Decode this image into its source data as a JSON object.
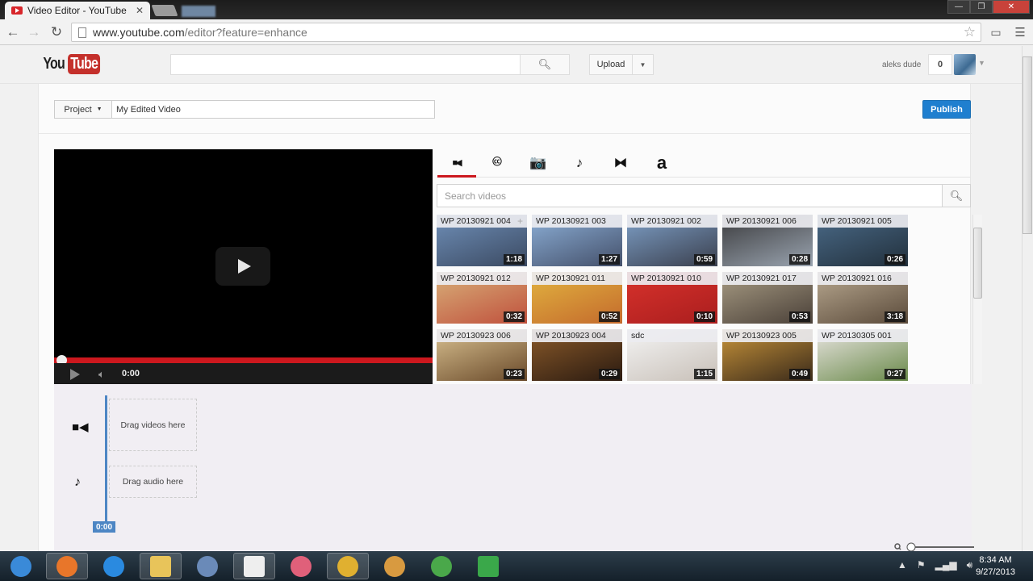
{
  "browser": {
    "tab_title": "Video Editor - YouTube",
    "tab_close": "✕",
    "url_host": "www.youtube.com",
    "url_path": "/editor?feature=enhance",
    "window_controls": [
      "—",
      "❐",
      "✕"
    ]
  },
  "header": {
    "logo_you": "You",
    "logo_tube": "Tube",
    "search_placeholder": "",
    "upload_label": "Upload",
    "username": "aleks dude",
    "notification_count": "0"
  },
  "project": {
    "menu_label": "Project",
    "name": "My Edited Video",
    "publish_label": "Publish"
  },
  "player": {
    "time": "0:00",
    "progress": 0
  },
  "tabs": [
    {
      "name": "tab-videos",
      "icon": "video-camera-icon",
      "glyph": "■◀",
      "active": true
    },
    {
      "name": "tab-creative-commons",
      "icon": "creative-commons-icon",
      "glyph": "🅭",
      "active": false
    },
    {
      "name": "tab-photos",
      "icon": "camera-icon",
      "glyph": "📷",
      "active": false
    },
    {
      "name": "tab-audio",
      "icon": "music-note-icon",
      "glyph": "♪",
      "active": false
    },
    {
      "name": "tab-transitions",
      "icon": "transition-icon",
      "glyph": "⧓",
      "active": false
    },
    {
      "name": "tab-text",
      "icon": "text-icon",
      "glyph": "a",
      "active": false
    }
  ],
  "video_search": {
    "placeholder": "Search videos"
  },
  "videos": [
    {
      "title": "WP 20130921 004",
      "duration": "1:18",
      "colors": [
        "#6f8fb8",
        "#3b4a62"
      ]
    },
    {
      "title": "WP 20130921 003",
      "duration": "1:27",
      "colors": [
        "#8db0d8",
        "#44506a"
      ]
    },
    {
      "title": "WP 20130921 002",
      "duration": "0:59",
      "colors": [
        "#7ea0c8",
        "#3a3f4d"
      ]
    },
    {
      "title": "WP 20130921 006",
      "duration": "0:28",
      "colors": [
        "#3a3a3c",
        "#9aa4b0"
      ]
    },
    {
      "title": "WP 20130921 005",
      "duration": "0:26",
      "colors": [
        "#4a6a88",
        "#22303c"
      ]
    },
    {
      "title": "WP 20130921 012",
      "duration": "0:32",
      "colors": [
        "#d8b07a",
        "#c0503c"
      ]
    },
    {
      "title": "WP 20130921 011",
      "duration": "0:52",
      "colors": [
        "#e2b440",
        "#c46a2c"
      ]
    },
    {
      "title": "WP 20130921 010",
      "duration": "0:10",
      "colors": [
        "#d8322c",
        "#aa1e1e"
      ]
    },
    {
      "title": "WP 20130921 017",
      "duration": "0:53",
      "colors": [
        "#a89c84",
        "#4a4038"
      ]
    },
    {
      "title": "WP 20130921 016",
      "duration": "3:18",
      "colors": [
        "#b8a890",
        "#5a4a3a"
      ]
    },
    {
      "title": "WP 20130923 006",
      "duration": "0:23",
      "colors": [
        "#d8c090",
        "#6a4a2a"
      ]
    },
    {
      "title": "WP 20130923 004",
      "duration": "0:29",
      "colors": [
        "#8a5a2a",
        "#2a1a10"
      ]
    },
    {
      "title": "sdc",
      "duration": "1:15",
      "colors": [
        "#f4f4f4",
        "#c8c0b8"
      ]
    },
    {
      "title": "WP 20130923 005",
      "duration": "0:49",
      "colors": [
        "#c8943a",
        "#3a2a1a"
      ]
    },
    {
      "title": "WP 20130305 001",
      "duration": "0:27",
      "colors": [
        "#e8e4e0",
        "#6a8a4a"
      ]
    }
  ],
  "timeline": {
    "video_drop_label": "Drag videos here",
    "audio_drop_label": "Drag audio here",
    "playhead_time": "0:00",
    "zoom_level": 0
  },
  "taskbar": {
    "items": [
      {
        "name": "start-button",
        "color": "#3a8ad8",
        "active": false
      },
      {
        "name": "firefox",
        "color": "#e8762a",
        "active": true
      },
      {
        "name": "internet-explorer",
        "color": "#2a8ae0",
        "active": false
      },
      {
        "name": "file-explorer",
        "color": "#e8c45a",
        "active": true
      },
      {
        "name": "virtualbox",
        "color": "#6a8ab8",
        "active": false
      },
      {
        "name": "video-app",
        "color": "#eeeeee",
        "active": true
      },
      {
        "name": "zune",
        "color": "#e0607a",
        "active": false
      },
      {
        "name": "chrome",
        "color": "#e0b030",
        "active": true
      },
      {
        "name": "wine-app",
        "color": "#d89a40",
        "active": false
      },
      {
        "name": "utorrent",
        "color": "#4aa84a",
        "active": false
      },
      {
        "name": "green-app",
        "color": "#3aa84a",
        "active": false
      }
    ],
    "time": "8:34 AM",
    "date": "9/27/2013"
  }
}
